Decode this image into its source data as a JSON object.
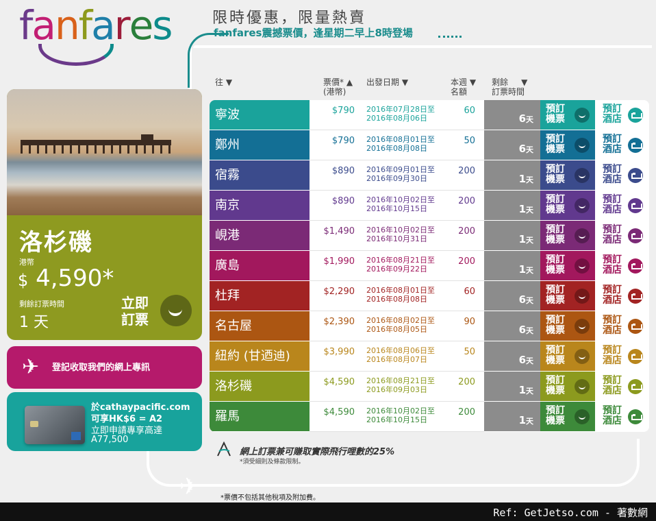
{
  "brand": {
    "letters": [
      {
        "ch": "f",
        "color": "#6b3a8a"
      },
      {
        "ch": "a",
        "color": "#c21f73"
      },
      {
        "ch": "n",
        "color": "#d9611a"
      },
      {
        "ch": "f",
        "color": "#8d9a1d"
      },
      {
        "ch": "a",
        "color": "#1f7fa8"
      },
      {
        "ch": "r",
        "color": "#9c1c3a"
      },
      {
        "ch": "e",
        "color": "#2a7f3b"
      },
      {
        "ch": "s",
        "color": "#0d8b8b"
      }
    ]
  },
  "header": {
    "headline": "限時優惠，限量熱賣",
    "subline": "fanfares震撼票價，逢星期二早上8時登場"
  },
  "promo": {
    "city": "洛杉磯",
    "currency_label": "港幣",
    "price_symbol": "$",
    "price": "4,590*",
    "remaining_label": "剩餘訂票時間",
    "remaining": "1 天",
    "book_label": "立即訂票"
  },
  "newsletter": {
    "label": "登記收取我們的網上專訊"
  },
  "card_promo": {
    "line1": "於cathaypacific.com",
    "line2": "可享HK$6 = A2",
    "line3": "立即申請專享高達",
    "line4": "A77,500"
  },
  "table": {
    "headers": {
      "dest": "往 ▼",
      "price": "票價* ▲",
      "price_sub": "(港幣)",
      "dates": "出發日期 ▼",
      "quota": "本週",
      "quota_sub": "名額",
      "quota_arrow": "▼",
      "remain": "剩餘",
      "remain_sub": "訂票時間",
      "remain_arrow": "▼"
    },
    "book_label": "預訂機票",
    "hotel_label": "預訂酒店",
    "day_unit": "天",
    "rows": [
      {
        "dest": "寧波",
        "price": "$790",
        "d1": "2016年07月28日至",
        "d2": "2016年08月06日",
        "quota": "60",
        "remain": "6",
        "color": "#1aa39b",
        "dark": "#0f6f6a"
      },
      {
        "dest": "鄭州",
        "price": "$790",
        "d1": "2016年08月01日至",
        "d2": "2016年08月08日",
        "quota": "50",
        "remain": "6",
        "color": "#136f95",
        "dark": "#0c4d69"
      },
      {
        "dest": "宿霧",
        "price": "$890",
        "d1": "2016年09月01日至",
        "d2": "2016年09月30日",
        "quota": "200",
        "remain": "1",
        "color": "#3b4b8c",
        "dark": "#293463"
      },
      {
        "dest": "南京",
        "price": "$890",
        "d1": "2016年10月02日至",
        "d2": "2016年10月15日",
        "quota": "200",
        "remain": "1",
        "color": "#61398e",
        "dark": "#432764"
      },
      {
        "dest": "峴港",
        "price": "$1,490",
        "d1": "2016年10月02日至",
        "d2": "2016年10月31日",
        "quota": "200",
        "remain": "1",
        "color": "#7b2a76",
        "dark": "#561d52"
      },
      {
        "dest": "廣島",
        "price": "$1,990",
        "d1": "2016年08月21日至",
        "d2": "2016年09月22日",
        "quota": "200",
        "remain": "1",
        "color": "#a2185d",
        "dark": "#721041"
      },
      {
        "dest": "杜拜",
        "price": "$2,290",
        "d1": "2016年08月01日至",
        "d2": "2016年08月08日",
        "quota": "60",
        "remain": "6",
        "color": "#a22323",
        "dark": "#731818"
      },
      {
        "dest": "名古屋",
        "price": "$2,390",
        "d1": "2016年08月02日至",
        "d2": "2016年08月05日",
        "quota": "90",
        "remain": "6",
        "color": "#ac5612",
        "dark": "#7a3c0c"
      },
      {
        "dest": "紐約 (甘迺迪)",
        "price": "$3,990",
        "d1": "2016年08月06日至",
        "d2": "2016年08月07日",
        "quota": "50",
        "remain": "6",
        "color": "#b9861c",
        "dark": "#835f13"
      },
      {
        "dest": "洛杉磯",
        "price": "$4,590",
        "d1": "2016年08月21日至",
        "d2": "2016年09月03日",
        "quota": "200",
        "remain": "1",
        "color": "#8c9a1e",
        "dark": "#626c14"
      },
      {
        "dest": "羅馬",
        "price": "$4,590",
        "d1": "2016年10月02日至",
        "d2": "2016年10月15日",
        "quota": "200",
        "remain": "1",
        "color": "#3d8a3a",
        "dark": "#2a6128"
      }
    ]
  },
  "miles": {
    "text": "網上訂票兼可賺取實際飛行哩數的25%",
    "note": "*須受細則及條款限制。"
  },
  "footnote": "*票價不包括其他稅項及附加費。",
  "ref": "Ref: GetJetso.com - 著數網"
}
